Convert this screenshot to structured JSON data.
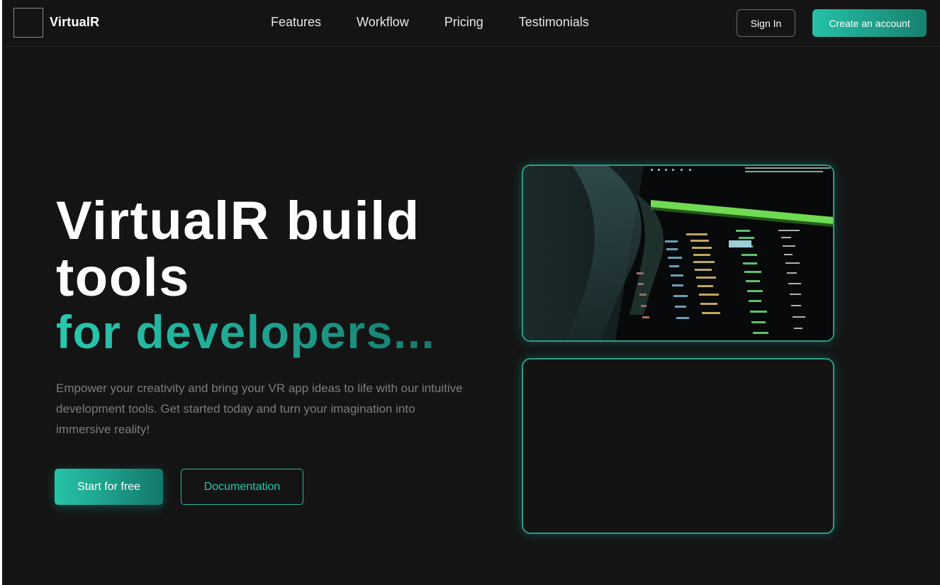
{
  "nav": {
    "brand": "VirtualR",
    "links": [
      "Features",
      "Workflow",
      "Pricing",
      "Testimonials"
    ],
    "signin_label": "Sign In",
    "create_label": "Create an account"
  },
  "hero": {
    "title_line1": "VirtualR build",
    "title_line2": "tools",
    "title_accent": "for developers...",
    "description": "Empower your creativity and bring your VR app ideas to life with our intuitive development tools. Get started today and turn your imagination into immersive reality!",
    "primary_button": "Start for free",
    "secondary_button": "Documentation"
  },
  "colors": {
    "background": "#141414",
    "accent": "#25c2a6",
    "accent_dark": "#16806f",
    "muted_text": "#7c7c7c"
  },
  "icons": {
    "logo": "logo-placeholder-icon"
  }
}
